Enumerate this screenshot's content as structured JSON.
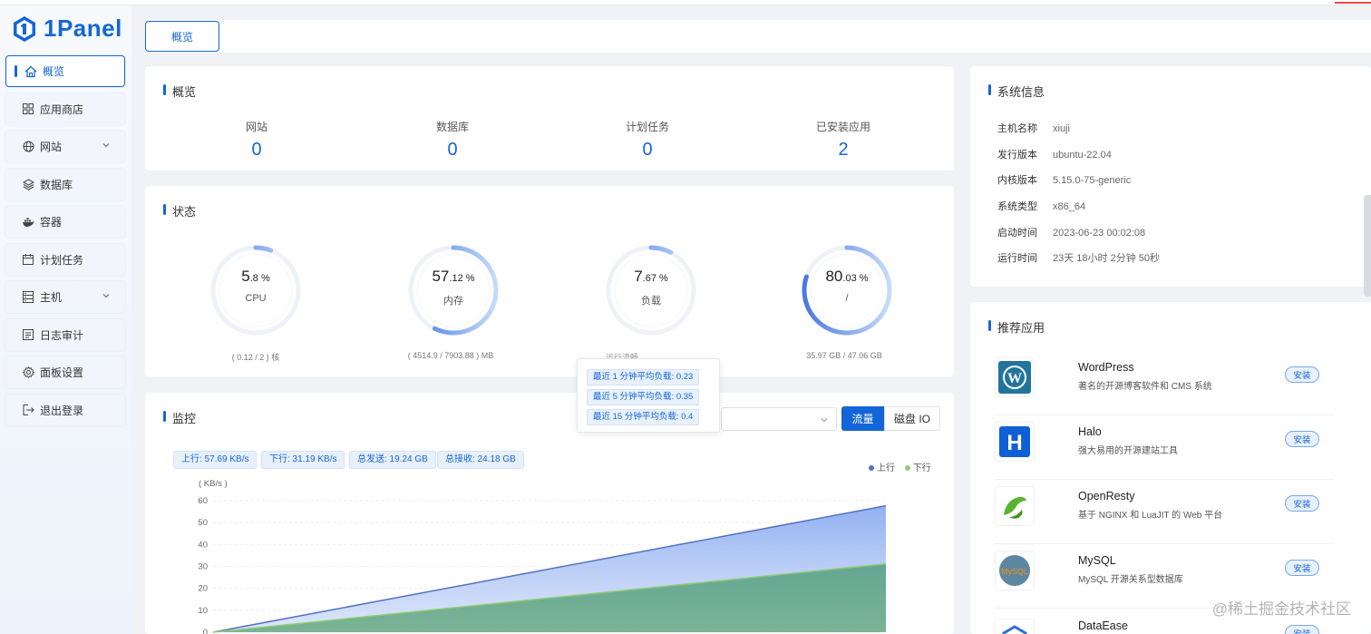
{
  "brand": {
    "name": "1Panel",
    "color": "#1366d8"
  },
  "sidebar": {
    "items": [
      {
        "label": "概览",
        "icon": "home-icon",
        "active": true
      },
      {
        "label": "应用商店",
        "icon": "grid-icon"
      },
      {
        "label": "网站",
        "icon": "globe-icon",
        "expandable": true
      },
      {
        "label": "数据库",
        "icon": "layers-icon"
      },
      {
        "label": "容器",
        "icon": "docker-icon"
      },
      {
        "label": "计划任务",
        "icon": "calendar-icon"
      },
      {
        "label": "主机",
        "icon": "host-icon",
        "expandable": true
      },
      {
        "label": "日志审计",
        "icon": "log-icon"
      },
      {
        "label": "面板设置",
        "icon": "gear-icon"
      },
      {
        "label": "退出登录",
        "icon": "logout-icon"
      }
    ]
  },
  "tabs": [
    {
      "label": "概览"
    }
  ],
  "overview": {
    "title": "概览",
    "items": [
      {
        "label": "网站",
        "value": "0"
      },
      {
        "label": "数据库",
        "value": "0"
      },
      {
        "label": "计划任务",
        "value": "0"
      },
      {
        "label": "已安装应用",
        "value": "2"
      }
    ]
  },
  "status": {
    "title": "状态",
    "gauges": [
      {
        "int": "5",
        "dec": ".8 %",
        "name": "CPU",
        "percent": 5.8,
        "sub": "( 0.12 / 2 ) 核"
      },
      {
        "int": "57",
        "dec": ".12 %",
        "name": "内存",
        "percent": 57.12,
        "sub": "( 4514.9 / 7903.88 ) MB"
      },
      {
        "int": "7",
        "dec": ".67 %",
        "name": "负载",
        "percent": 7.67,
        "sub": "运行流畅"
      },
      {
        "int": "80",
        "dec": ".03 %",
        "name": "/",
        "percent": 80.03,
        "sub": "35.97 GB / 47.06 GB"
      }
    ]
  },
  "tooltip": {
    "lines": [
      "最近 1 分钟平均负载: 0.23",
      "最近 5 分钟平均负载: 0.35",
      "最近 15 分钟平均负载: 0.4"
    ]
  },
  "monitor": {
    "title": "监控",
    "chips": [
      "上行: 57.69 KB/s",
      "下行: 31.19 KB/s",
      "总发送: 19.24 GB",
      "总接收: 24.18 GB"
    ],
    "buttons": {
      "flow": "流量",
      "disk": "磁盘 IO"
    },
    "legend": [
      {
        "name": "上行",
        "color": "#5470c6"
      },
      {
        "name": "下行",
        "color": "#91cc75"
      }
    ],
    "unit": "( KB/s )"
  },
  "chart_data": {
    "type": "area",
    "ylabel": "( KB/s )",
    "ylim": [
      0,
      60
    ],
    "yticks": [
      0,
      10,
      20,
      30,
      40,
      50,
      60
    ],
    "x": [
      0,
      1
    ],
    "series": [
      {
        "name": "上行",
        "values": [
          0,
          57.69
        ],
        "color": "#5470c6"
      },
      {
        "name": "下行",
        "values": [
          0,
          31.19
        ],
        "color": "#91cc75"
      }
    ]
  },
  "system": {
    "title": "系统信息",
    "rows": [
      {
        "k": "主机名称",
        "v": "xiuji"
      },
      {
        "k": "发行版本",
        "v": "ubuntu-22.04"
      },
      {
        "k": "内核版本",
        "v": "5.15.0-75-generic"
      },
      {
        "k": "系统类型",
        "v": "x86_64"
      },
      {
        "k": "启动时间",
        "v": "2023-06-23 00:02:08"
      },
      {
        "k": "运行时间",
        "v": "23天 18小时 2分钟 50秒"
      }
    ]
  },
  "apps": {
    "title": "推荐应用",
    "install_label": "安装",
    "items": [
      {
        "name": "WordPress",
        "desc": "著名的开源博客软件和 CMS 系统",
        "icon": "wordpress-icon"
      },
      {
        "name": "Halo",
        "desc": "强大易用的开源建站工具",
        "icon": "halo-icon"
      },
      {
        "name": "OpenResty",
        "desc": "基于 NGINX 和 LuaJIT 的 Web 平台",
        "icon": "openresty-icon"
      },
      {
        "name": "MySQL",
        "desc": "MySQL 开源关系型数据库",
        "icon": "mysql-icon"
      },
      {
        "name": "DataEase",
        "desc": "",
        "icon": "dataease-icon"
      }
    ]
  },
  "watermark": "@稀土掘金技术社区"
}
